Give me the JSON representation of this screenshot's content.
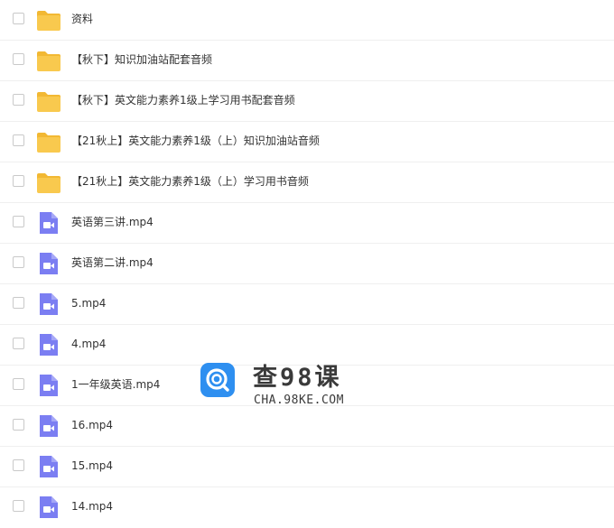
{
  "colors": {
    "folder": "#f9c94e",
    "folder_tab": "#f2b833",
    "video": "#7b7ef2",
    "row_divider": "#efefef",
    "watermark_logo": "#2e8ff0"
  },
  "files": [
    {
      "type": "folder",
      "icon": "folder-icon",
      "name": "资料"
    },
    {
      "type": "folder",
      "icon": "folder-icon",
      "name": "【秋下】知识加油站配套音频"
    },
    {
      "type": "folder",
      "icon": "folder-icon",
      "name": "【秋下】英文能力素养1级上学习用书配套音频"
    },
    {
      "type": "folder",
      "icon": "folder-icon",
      "name": "【21秋上】英文能力素养1级（上）知识加油站音频"
    },
    {
      "type": "folder",
      "icon": "folder-icon",
      "name": "【21秋上】英文能力素养1级（上）学习用书音频"
    },
    {
      "type": "video",
      "icon": "video-file-icon",
      "name": "英语第三讲.mp4"
    },
    {
      "type": "video",
      "icon": "video-file-icon",
      "name": "英语第二讲.mp4"
    },
    {
      "type": "video",
      "icon": "video-file-icon",
      "name": "5.mp4"
    },
    {
      "type": "video",
      "icon": "video-file-icon",
      "name": "4.mp4"
    },
    {
      "type": "video",
      "icon": "video-file-icon",
      "name": "1一年级英语.mp4"
    },
    {
      "type": "video",
      "icon": "video-file-icon",
      "name": "16.mp4"
    },
    {
      "type": "video",
      "icon": "video-file-icon",
      "name": "15.mp4"
    },
    {
      "type": "video",
      "icon": "video-file-icon",
      "name": "14.mp4"
    }
  ],
  "watermark": {
    "title": "查98课",
    "subtitle": "CHA.98KE.COM",
    "icon": "search-logo-icon"
  }
}
